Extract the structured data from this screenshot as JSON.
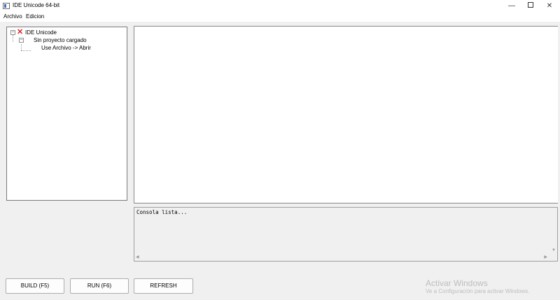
{
  "window": {
    "title": "IDE Unicode 64-bit",
    "controls": {
      "minimize": "—",
      "close": "✕"
    }
  },
  "menu": {
    "items": [
      "Archivo",
      "Edicion"
    ]
  },
  "tree": {
    "root": "IDE Unicode",
    "child": "Sin proyecto cargado",
    "grandchild": "Use Archivo -> Abrir",
    "expander": "−"
  },
  "editor": {
    "content": ""
  },
  "console": {
    "text": "Consola lista...",
    "scroll_left": "◀",
    "scroll_right": "▶",
    "scroll_down": "▼"
  },
  "buttons": {
    "build": "BUILD (F5)",
    "run": "RUN (F6)",
    "refresh": "REFRESH"
  },
  "watermark": {
    "title": "Activar Windows",
    "subtitle": "Ve a Configuración para activar Windows."
  },
  "colors": {
    "error_icon": "#e02020",
    "background": "#f0f0f0"
  },
  "icons": {
    "root_node": "x-icon",
    "app": "app-window-icon"
  }
}
